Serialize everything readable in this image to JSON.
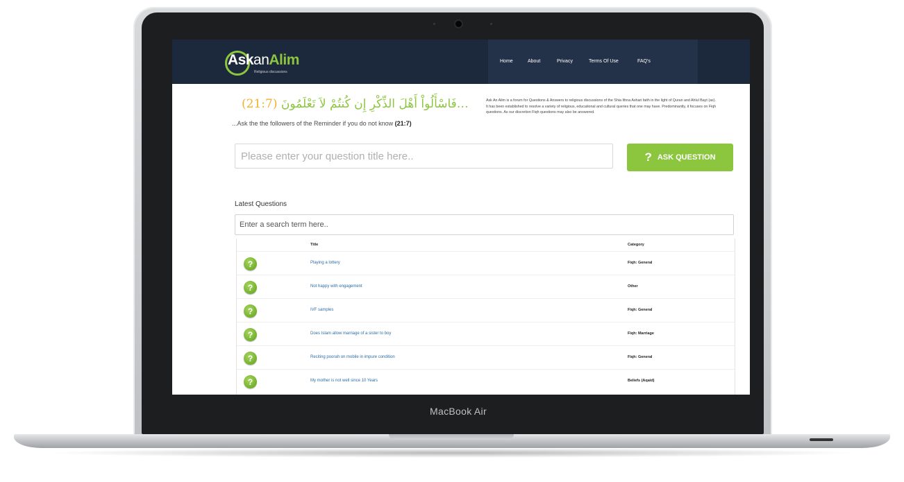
{
  "device": {
    "brand_label": "MacBook Air"
  },
  "site": {
    "logo": {
      "ask": "Ask",
      "an": "an",
      "alim": "Alim",
      "tagline": "Religious discussions"
    },
    "nav": [
      "Home",
      "About",
      "Privacy",
      "Terms Of Use",
      "FAQ's"
    ],
    "verse": {
      "arabic": "…فَاسْأَلُواْ أَهْلَ الذِّكْرِ إِن كُنتُمْ لاَ تَعْلَمُونَ",
      "arabic_ref": "(21:7)",
      "english": "...Ask the the followers of the Reminder if you do not know",
      "english_ref": "(21:7)"
    },
    "about_text": "Ask An Alim is a forum for Questions & Answers to religious discussions of the Shia Ithna Ashari faith in the light of Quran and Ahlul Bayt (as). It has been established to resolve a variety of religious, educational and cultural queries that one may have. Predominantly, it focuses on Fiqh questions. As our discretion Fiqh questions may also be answered.",
    "question_placeholder": "Please enter your question title here..",
    "ask_button": {
      "icon": "?",
      "label": "ASK QUESTION"
    },
    "latest_heading": "Latest Questions",
    "search_placeholder": "Enter a search term here..",
    "table": {
      "headers": {
        "title": "Title",
        "category": "Category"
      },
      "rows": [
        {
          "title": "Playing a lottery",
          "category": "Fiqh: General"
        },
        {
          "title": "Not happy with engagement",
          "category": "Other"
        },
        {
          "title": "IVF samples",
          "category": "Fiqh: General"
        },
        {
          "title": "Does Islam allow marriage of a sister to boy",
          "category": "Fiqh: Marriage"
        },
        {
          "title": "Reciting poorah on mobile in impure condition",
          "category": "Fiqh: General"
        },
        {
          "title": "My mother is not well since 10 Years",
          "category": "Beliefs (Aqaid)"
        }
      ]
    }
  },
  "colors": {
    "accent_green": "#8cc63f",
    "nav_bg": "#1c283b",
    "verse_ref": "#f0b22c",
    "link": "#2e6da4"
  }
}
